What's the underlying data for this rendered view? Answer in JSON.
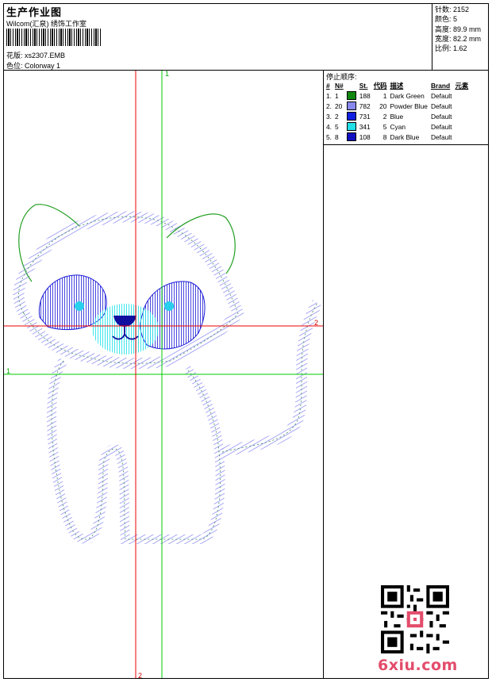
{
  "header": {
    "title": "生产作业图",
    "studio": "Wilcom(汇泉) 绣饰工作室",
    "design_label": "花版:",
    "design_value": "xs2307.EMB",
    "colorway_label": "色位:",
    "colorway_value": "Colorway 1"
  },
  "stats": [
    {
      "label": "针数:",
      "value": "2152"
    },
    {
      "label": "颜色:",
      "value": "5"
    },
    {
      "label": "高度:",
      "value": "89.9 mm"
    },
    {
      "label": "宽度:",
      "value": "82.2 mm"
    },
    {
      "label": "比例:",
      "value": "1.62"
    }
  ],
  "stop_sequence": {
    "title": "停止顺序:",
    "headers": [
      "#",
      "N#",
      "St.",
      "代码",
      "描述",
      "Brand",
      "元素"
    ],
    "rows": [
      {
        "num": "1.",
        "n": "1",
        "color": "#108810",
        "st": "188",
        "code": "1",
        "desc": "Dark Green",
        "brand": "Default"
      },
      {
        "num": "2.",
        "n": "20",
        "color": "#8888ee",
        "st": "782",
        "code": "20",
        "desc": "Powder Blue",
        "brand": "Default"
      },
      {
        "num": "3.",
        "n": "2",
        "color": "#1020e0",
        "st": "731",
        "code": "2",
        "desc": "Blue",
        "brand": "Default"
      },
      {
        "num": "4.",
        "n": "5",
        "color": "#22e0e8",
        "st": "341",
        "code": "5",
        "desc": "Cyan",
        "brand": "Default"
      },
      {
        "num": "5.",
        "n": "8",
        "color": "#1010c0",
        "st": "108",
        "code": "8",
        "desc": "Dark Blue",
        "brand": "Default"
      }
    ]
  },
  "guides": {
    "green_v": "1",
    "green_h": "1",
    "red_v": "2",
    "red_h": "2"
  },
  "watermark": "6xiu.com",
  "colors": {
    "guide_green": "#00cc00",
    "guide_red": "#ee0000"
  }
}
